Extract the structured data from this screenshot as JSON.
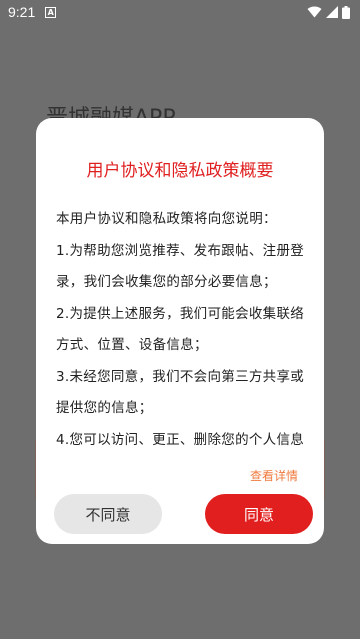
{
  "status_bar": {
    "time": "9:21",
    "notification_letter": "A",
    "icons": [
      "wifi-icon",
      "signal-icon",
      "battery-icon"
    ]
  },
  "background": {
    "app_title": "晋城融媒APP"
  },
  "dialog": {
    "title": "用户协议和隐私政策概要",
    "paragraphs": [
      "本用户协议和隐私政策将向您说明：",
      "1.为帮助您浏览推荐、发布跟帖、注册登录，我们会收集您的部分必要信息；",
      "2.为提供上述服务，我们可能会收集联络方式、位置、设备信息；",
      "3.未经您同意，我们不会向第三方共享或提供您的信息；",
      "4.您可以访问、更正、删除您的个人信息"
    ],
    "details_link": "查看详情",
    "disagree_label": "不同意",
    "agree_label": "同意"
  },
  "colors": {
    "title": "#e02020",
    "agree_button": "#e21f1f",
    "disagree_button": "#e6e6e6",
    "link": "#f07b3f",
    "scrim": "#6e6e6e"
  }
}
